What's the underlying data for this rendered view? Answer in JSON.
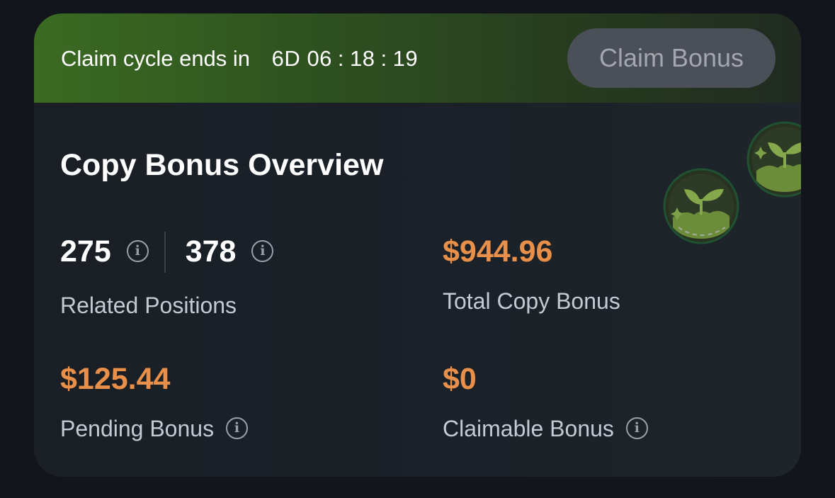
{
  "banner": {
    "cycle_label": "Claim cycle ends in",
    "timer": {
      "days": "6D",
      "hours": "06",
      "minutes": "18",
      "seconds": "19",
      "separator": ":"
    },
    "claim_button": "Claim Bonus"
  },
  "overview": {
    "title": "Copy Bonus Overview",
    "positions": {
      "first": "275",
      "second": "378",
      "label": "Related Positions"
    },
    "total": {
      "value": "$944.96",
      "label": "Total Copy Bonus"
    },
    "pending": {
      "value": "$125.44",
      "label": "Pending Bonus"
    },
    "claimable": {
      "value": "$0",
      "label": "Claimable Bonus"
    }
  },
  "icons": [
    "info-icon",
    "sprout-badge-icon"
  ],
  "colors": {
    "accent": "#e8904a",
    "banner_green": "#3b6b22",
    "card_bg": "#1b2128",
    "page_bg": "#13151c"
  }
}
